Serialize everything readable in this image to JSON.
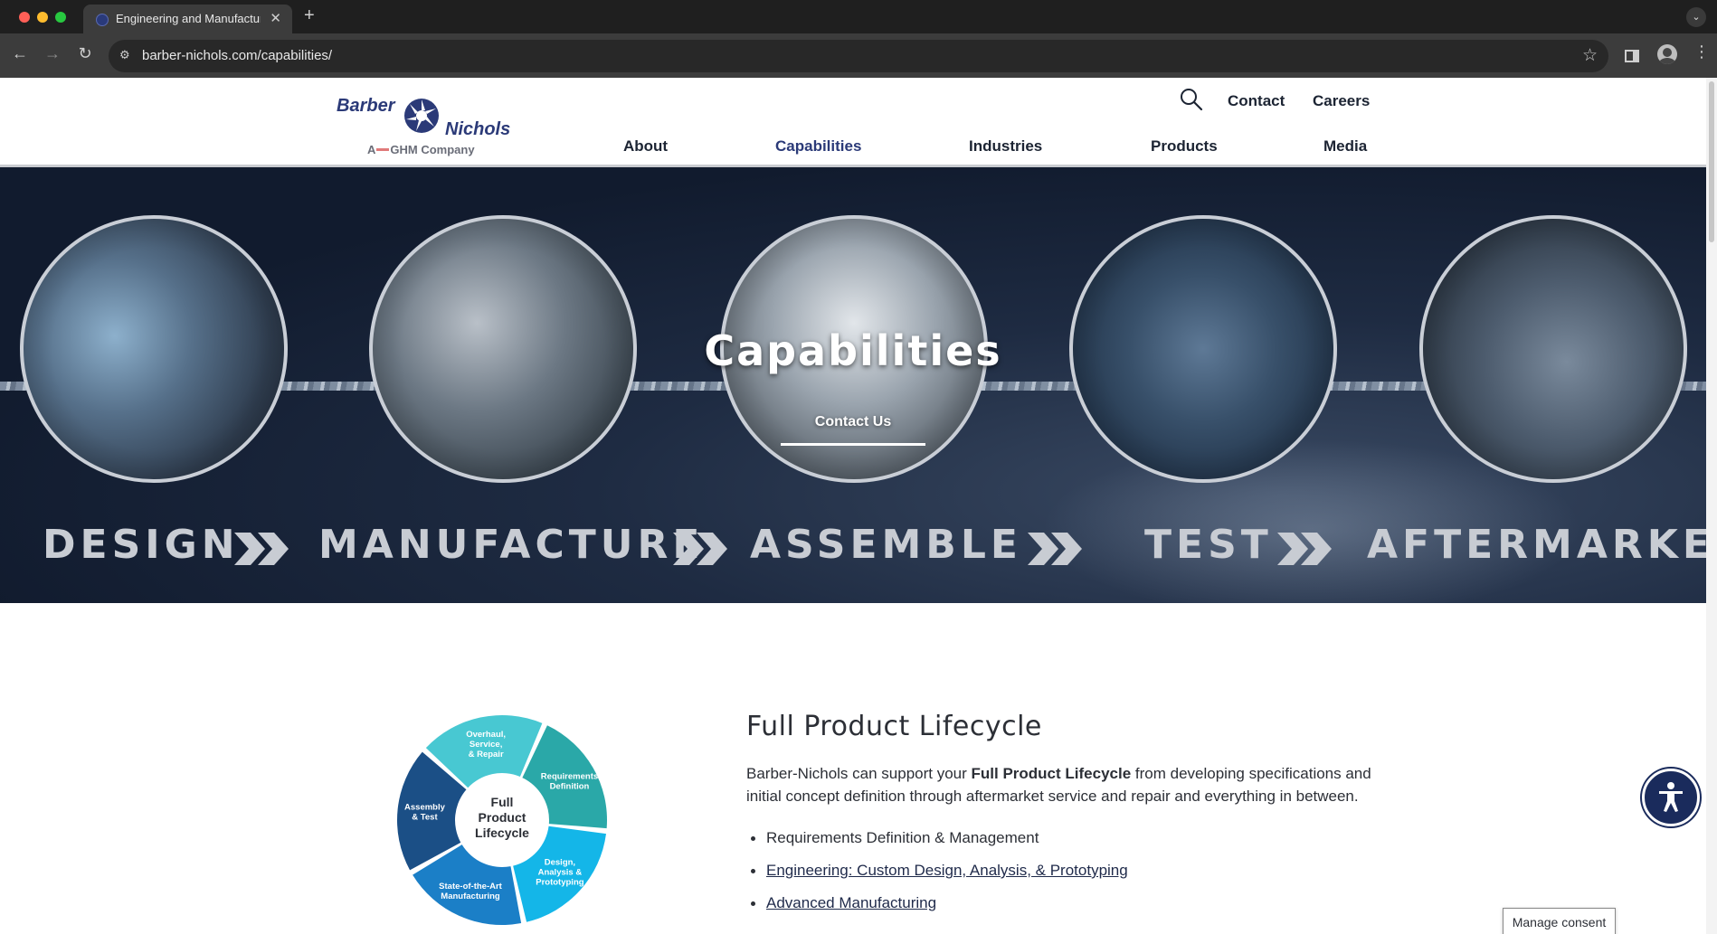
{
  "browser": {
    "tab_title": "Engineering and Manufacturing",
    "tab_close": "✕",
    "new_tab": "+",
    "url": "barber-nichols.com/capabilities/"
  },
  "header": {
    "logo": {
      "word1": "Barber",
      "word2": "Nichols",
      "tagline_prefix": "A",
      "tagline_suffix": "GHM Company"
    },
    "utility_nav": [
      {
        "label": "Contact"
      },
      {
        "label": "Careers"
      }
    ],
    "main_nav": [
      {
        "label": "About"
      },
      {
        "label": "Capabilities"
      },
      {
        "label": "Industries"
      },
      {
        "label": "Products"
      },
      {
        "label": "Media"
      }
    ]
  },
  "hero": {
    "title": "Capabilities",
    "cta": "Contact Us",
    "steps": [
      "DESIGN",
      "MANUFACTURE",
      "ASSEMBLE",
      "TEST",
      "AFTERMARKET"
    ]
  },
  "lifecycle": {
    "center_line1": "Full",
    "center_line2": "Product",
    "center_line3": "Lifecycle",
    "segments": [
      {
        "line1": "Requirements",
        "line2": "Definition",
        "line3": "",
        "color": "#2aa8a8"
      },
      {
        "line1": "Design,",
        "line2": "Analysis &",
        "line3": "Prototyping",
        "color": "#14b6e8"
      },
      {
        "line1": "State-of-the-Art",
        "line2": "Manufacturing",
        "line3": "",
        "color": "#1b7fc7"
      },
      {
        "line1": "Assembly",
        "line2": "& Test",
        "line3": "",
        "color": "#1b4f86"
      },
      {
        "line1": "Overhaul,",
        "line2": "Service,",
        "line3": "& Repair",
        "color": "#48c8d2"
      }
    ]
  },
  "content": {
    "heading": "Full Product Lifecycle",
    "intro_part1": "Barber-Nichols can support your ",
    "intro_bold": "Full Product Lifecycle",
    "intro_part2": " from developing specifications and initial concept definition through aftermarket service and repair and everything in between.",
    "items": [
      {
        "label": "Requirements Definition & Management",
        "link": false
      },
      {
        "label": "Engineering: Custom Design, Analysis, & Prototyping",
        "link": true
      },
      {
        "label": "Advanced Manufacturing",
        "link": true
      }
    ]
  },
  "overlays": {
    "consent": "Manage consent"
  },
  "colors": {
    "brand_navy": "#2b3a78",
    "hero_dark": "#111b2e",
    "accessibility_bg": "#1a2b5c"
  }
}
